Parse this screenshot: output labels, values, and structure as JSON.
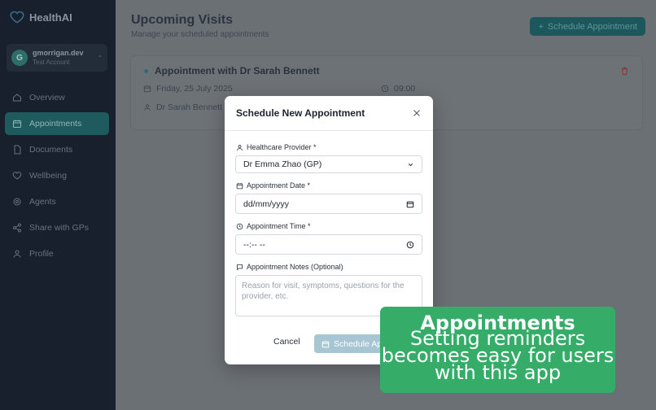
{
  "app": {
    "brand": "HealthAI"
  },
  "user": {
    "initial": "G",
    "name": "gmorrigan.dev",
    "role": "Test Account"
  },
  "nav": [
    {
      "label": "Overview",
      "icon": "home-icon",
      "active": false
    },
    {
      "label": "Appointments",
      "icon": "calendar-icon",
      "active": true
    },
    {
      "label": "Documents",
      "icon": "document-icon",
      "active": false
    },
    {
      "label": "Wellbeing",
      "icon": "heart-icon",
      "active": false
    },
    {
      "label": "Agents",
      "icon": "agent-icon",
      "active": false
    },
    {
      "label": "Share with GPs",
      "icon": "share-icon",
      "active": false
    },
    {
      "label": "Profile",
      "icon": "user-icon",
      "active": false
    }
  ],
  "page": {
    "title": "Upcoming Visits",
    "subtitle": "Manage your scheduled appointments",
    "schedule_button": "Schedule Appointment"
  },
  "appointment": {
    "title": "Appointment with Dr Sarah Bennett",
    "date": "Friday, 25 July 2025",
    "time": "09:00",
    "doctor": "Dr Sarah Bennett"
  },
  "modal": {
    "title": "Schedule New Appointment",
    "provider_label": "Healthcare Provider *",
    "provider_value": "Dr Emma Zhao (GP)",
    "date_label": "Appointment Date *",
    "date_placeholder": "dd/mm/yyyy",
    "time_label": "Appointment Time *",
    "time_placeholder": "--:-- --",
    "notes_label": "Appointment Notes (Optional)",
    "notes_placeholder": "Reason for visit, symptoms, questions for the provider, etc.",
    "cancel": "Cancel",
    "submit": "Schedule Appointment"
  },
  "promo": {
    "title": "Appointments",
    "lines": [
      "Setting reminders",
      "becomes easy for users",
      "with this app"
    ]
  },
  "colors": {
    "accent": "#1f5a5e",
    "promo": "#35ad68",
    "submit_disabled": "#a7c6d3"
  }
}
